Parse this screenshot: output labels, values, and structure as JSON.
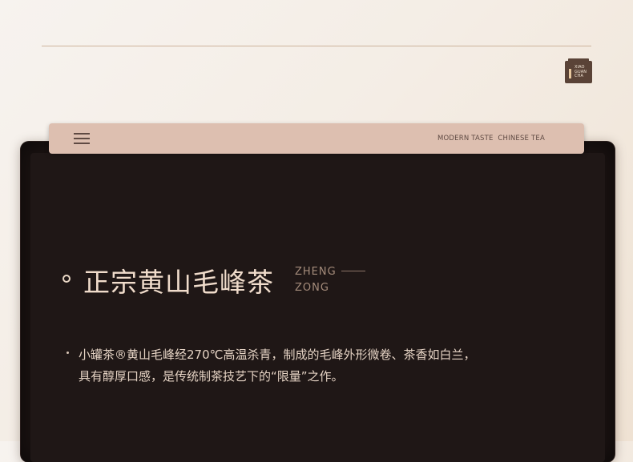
{
  "logo": {
    "text_lines": [
      "XIAO",
      "GUAN",
      "CHA"
    ]
  },
  "nav": {
    "menu_icon": "hamburger-menu-icon",
    "tagline": "MODERN TASTE  CHINESE TEA"
  },
  "section": {
    "title": "正宗黄山毛峰茶",
    "subtitle_line1": "ZHENG",
    "subtitle_line2": "ZONG",
    "description_line1": "小罐茶®黄山毛峰经270℃高温杀青，制成的毛峰外形微卷、茶香如白兰，",
    "description_line2": "具有醇厚口感，是传统制茶技艺下的“限量”之作。"
  },
  "colors": {
    "background": "#f4ede5",
    "nav_bar": "#ddbfb0",
    "device": "#1b1312",
    "title_text": "#f0dccb",
    "accent_line": "#cdb49c"
  }
}
